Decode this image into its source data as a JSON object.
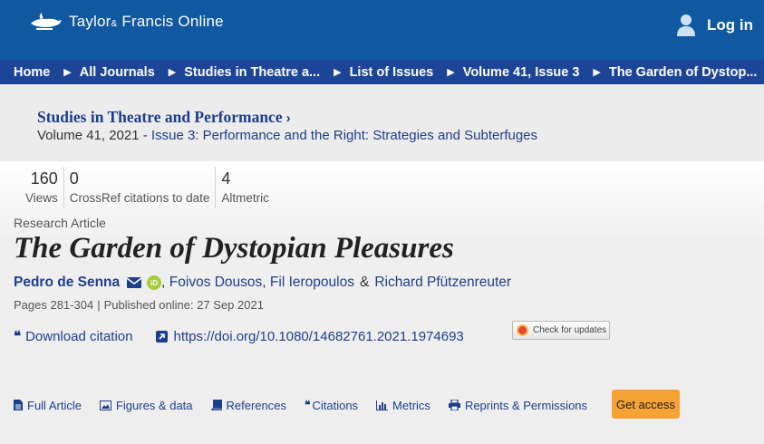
{
  "header": {
    "brand": "Taylor",
    "brand_amp": "&",
    "brand_rest": "Francis Online",
    "login_label": "Log in",
    "colors": {
      "topbar": "#10589f",
      "breadcrumb_bar": "#1d4597",
      "link": "#1d3e8a",
      "accent_button": "#f6a234"
    }
  },
  "breadcrumb": [
    {
      "label": "Home"
    },
    {
      "label": "All Journals"
    },
    {
      "label": "Studies in Theatre a..."
    },
    {
      "label": "List of Issues"
    },
    {
      "label": "Volume 41, Issue 3"
    },
    {
      "label": "The Garden of Dystop..."
    }
  ],
  "journal": {
    "title": "Studies in Theatre and Performance",
    "volume": "Volume 41, 2021",
    "dash": " - ",
    "issue": "Issue 3: Performance and the Right: Strategies and Subterfuges"
  },
  "metrics": [
    {
      "value": "160",
      "label": "Views"
    },
    {
      "value": "0",
      "label": "CrossRef citations to date"
    },
    {
      "value": "4",
      "label": "Altmetric"
    }
  ],
  "article": {
    "type": "Research Article",
    "title": "The Garden of Dystopian Pleasures",
    "authors": {
      "first": "Pedro de Senna",
      "comma": ",",
      "second": "Foivos Dousos",
      "third": "Fil Ieropoulos",
      "amp": "&",
      "fourth": "Richard Pfützenreuter"
    },
    "pages": "Pages 281-304",
    "bar": "|",
    "published": "Published online: 27 Sep 2021",
    "download_citation": "Download citation",
    "doi": "https://doi.org/10.1080/14682761.2021.1974693",
    "check_updates": "Check for updates",
    "orcid": "iD"
  },
  "tabs": [
    {
      "label": "Full Article",
      "icon": "document-icon"
    },
    {
      "label": "Figures & data",
      "icon": "image-icon"
    },
    {
      "label": "References",
      "icon": "book-icon"
    },
    {
      "label": "Citations",
      "icon": "quote-icon"
    },
    {
      "label": "Metrics",
      "icon": "bar-chart-icon"
    },
    {
      "label": "Reprints & Permissions",
      "icon": "printer-icon"
    }
  ],
  "access_button": "Get access"
}
